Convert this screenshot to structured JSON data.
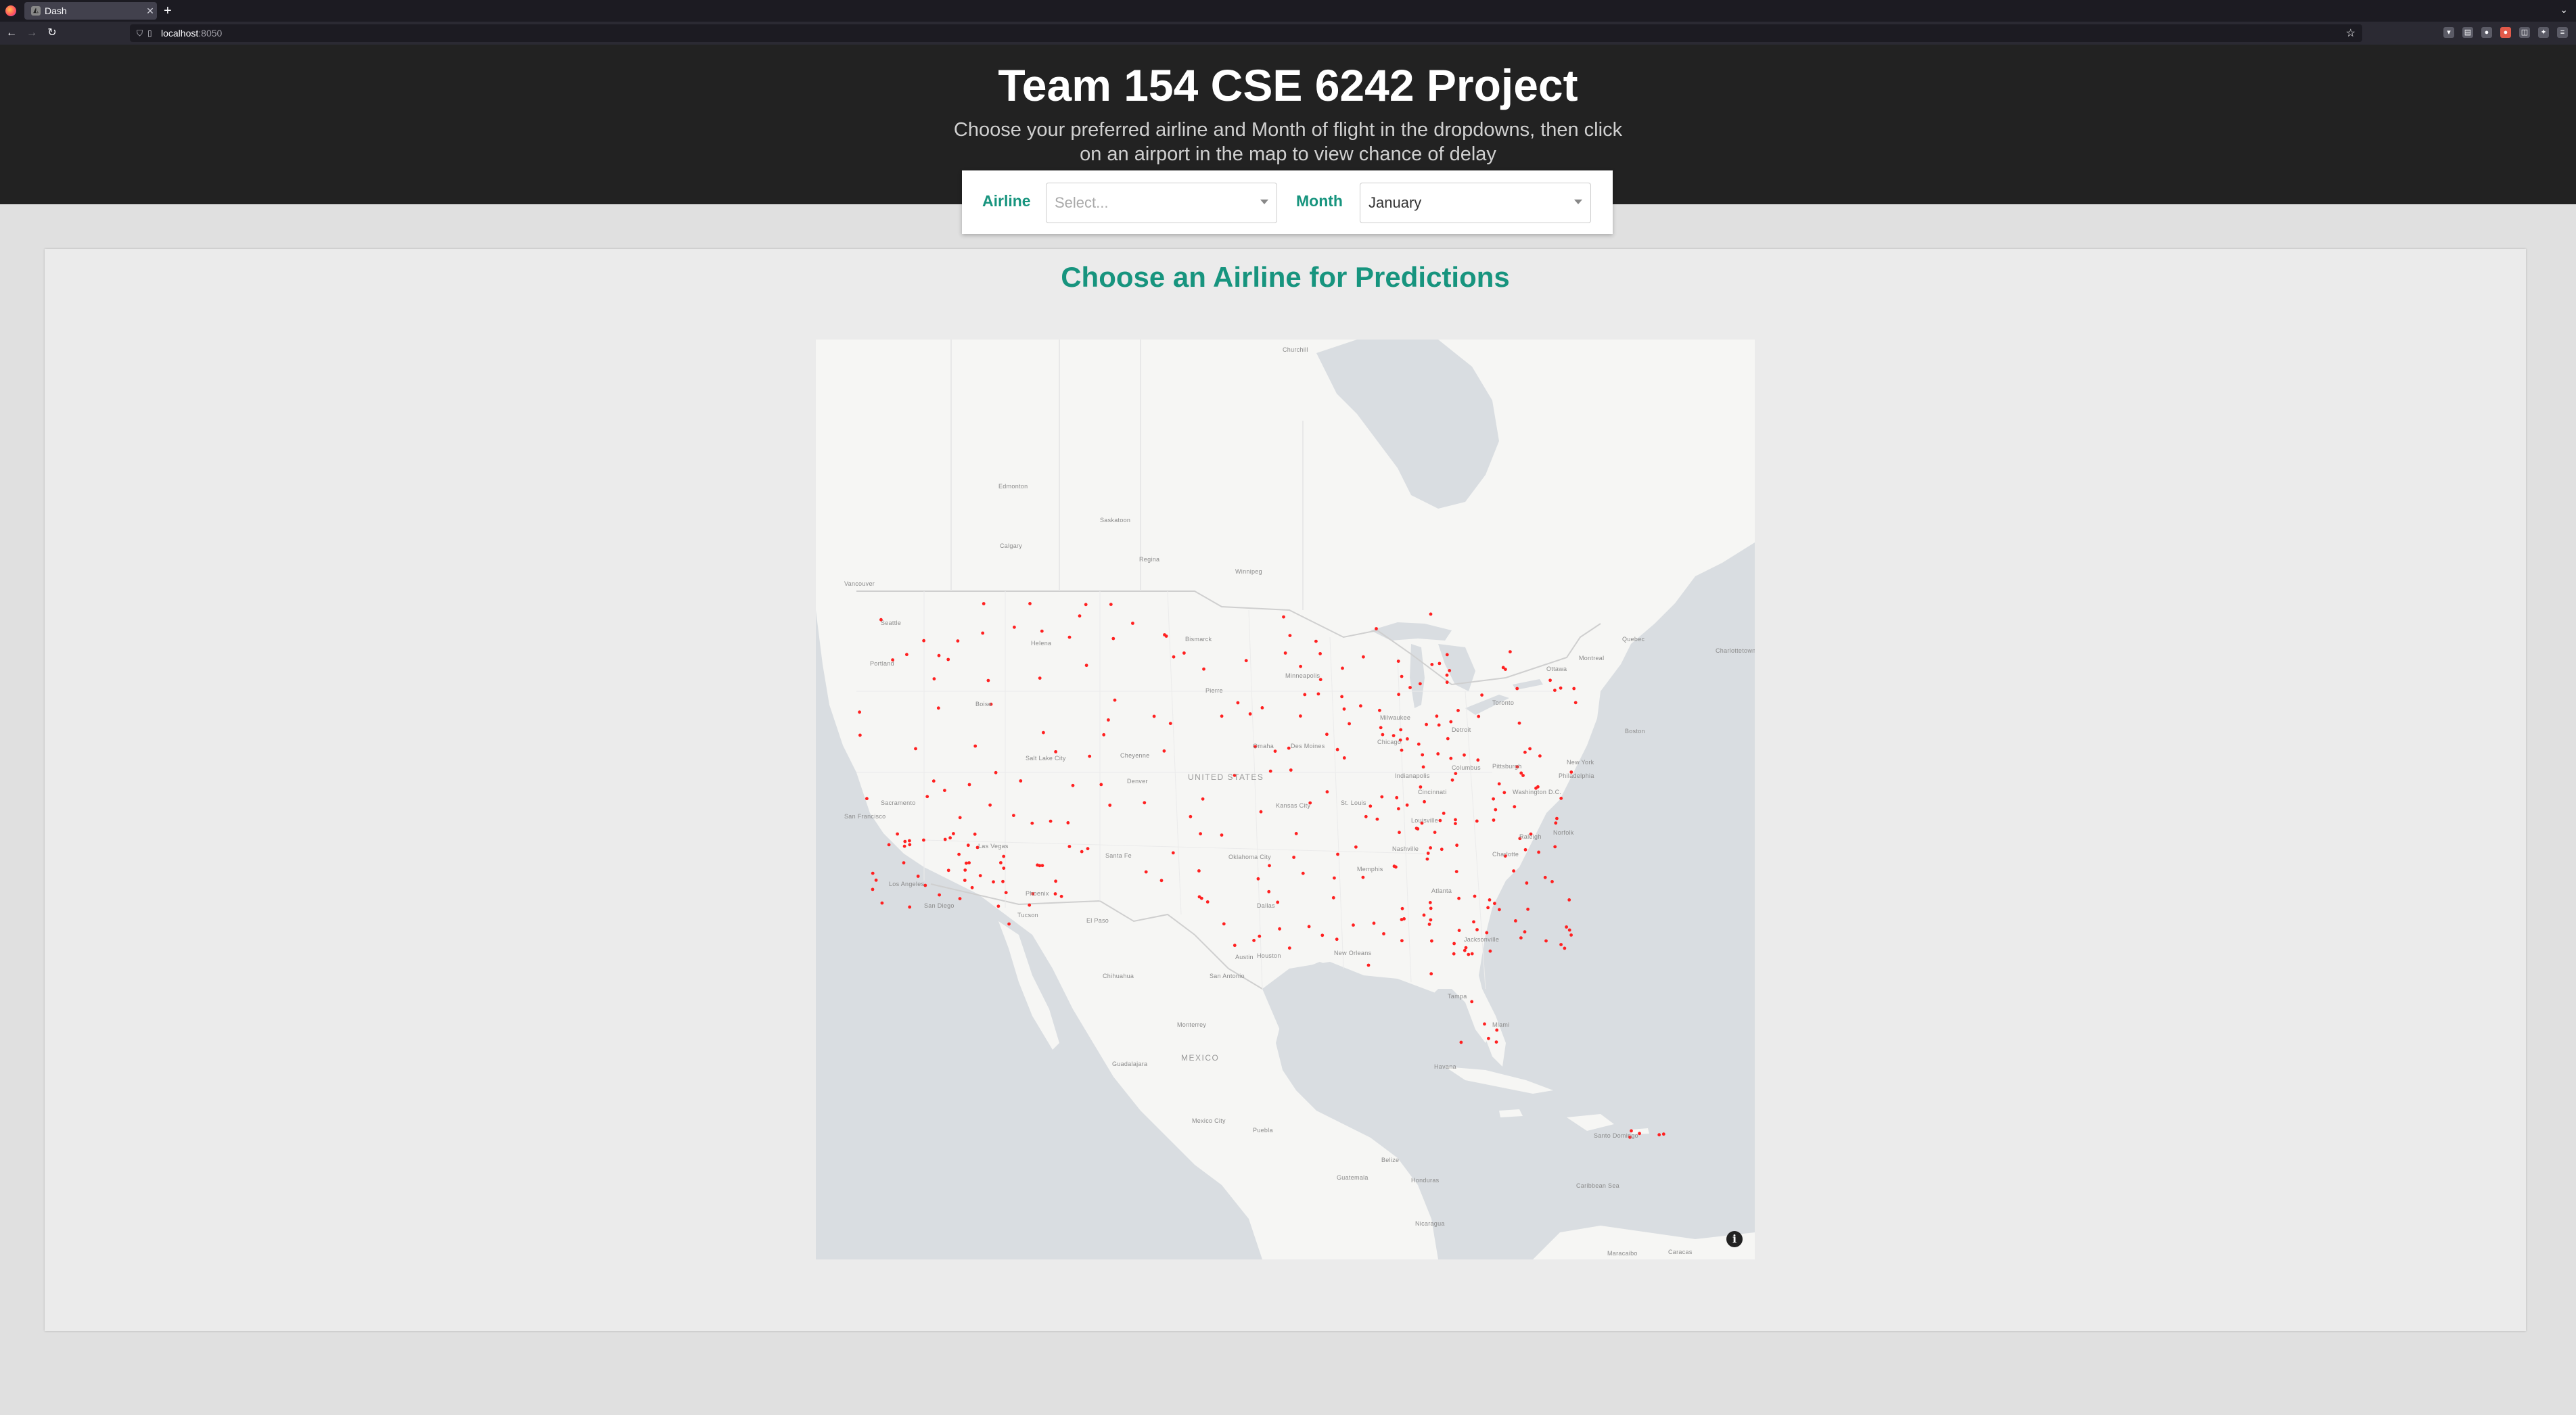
{
  "browser": {
    "tab_title": "Dash",
    "url_host": "localhost",
    "url_port": ":8050"
  },
  "header": {
    "title": "Team 154 CSE 6242 Project",
    "subtitle": "Choose your preferred airline and Month of flight in the dropdowns, then click on an airport in the map to view chance of delay"
  },
  "controls": {
    "airline_label": "Airline",
    "airline_placeholder": "Select...",
    "month_label": "Month",
    "month_value": "January"
  },
  "main": {
    "panel_title": "Choose an Airline for Predictions",
    "map_info_icon": "info-icon",
    "marker_color": "#ff2020"
  },
  "map_labels": {
    "country_us": "UNITED STATES",
    "country_mexico": "MEXICO",
    "cities": [
      "Churchill",
      "Edmonton",
      "Saskatoon",
      "Calgary",
      "Regina",
      "Winnipeg",
      "Vancouver",
      "Seattle",
      "Portland",
      "Boise",
      "Helena",
      "Bismarck",
      "Pierre",
      "Minneapolis",
      "Salt Lake City",
      "Cheyenne",
      "Denver",
      "Omaha",
      "Des Moines",
      "Chicago",
      "Milwaukee",
      "Detroit",
      "Toronto",
      "Ottawa",
      "Montreal",
      "Quebec",
      "Charlottetown",
      "Boston",
      "New York",
      "Philadelphia",
      "Washington D.C.",
      "Pittsburgh",
      "Columbus",
      "Cincinnati",
      "Indianapolis",
      "St. Louis",
      "Kansas City",
      "Nashville",
      "Louisville",
      "Raleigh",
      "Norfolk",
      "Charlotte",
      "Atlanta",
      "Memphis",
      "Oklahoma City",
      "Dallas",
      "Austin",
      "San Antonio",
      "Houston",
      "New Orleans",
      "Jacksonville",
      "Tampa",
      "Miami",
      "Sacramento",
      "San Francisco",
      "Las Vegas",
      "Los Angeles",
      "San Diego",
      "Phoenix",
      "Tucson",
      "El Paso",
      "Santa Fe",
      "Chihuahua",
      "Monterrey",
      "Guadalajara",
      "Mexico City",
      "Puebla",
      "Havana",
      "Santo Domingo",
      "Caribbean Sea",
      "Guatemala",
      "Honduras",
      "Nicaragua",
      "Caracas",
      "Maracaibo",
      "Belize"
    ]
  }
}
